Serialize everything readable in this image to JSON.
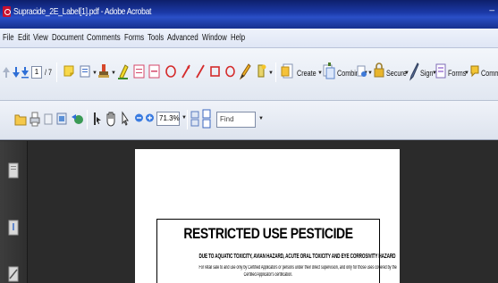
{
  "window": {
    "title": "Supracide_2E_Label[1].pdf - Adobe Acrobat",
    "minimize_glyph": "_"
  },
  "menu": [
    "File",
    "Edit",
    "View",
    "Document",
    "Comments",
    "Forms",
    "Tools",
    "Advanced",
    "Window",
    "Help"
  ],
  "toolbar": {
    "page_current": "1",
    "page_total": "/ 7",
    "create_label": "Create",
    "combine_label": "Combine",
    "secure_label": "Secure",
    "sign_label": "Sign",
    "forms_label": "Forms",
    "comment_label": "Comment"
  },
  "toolbar2": {
    "zoom_value": "71.3%",
    "find_placeholder": "Find"
  },
  "document": {
    "heading": "RESTRICTED USE PESTICIDE",
    "subheading": "DUE TO AQUATIC TOXICITY, AVIAN HAZARD, ACUTE ORAL TOXICITY AND EYE CORROSIVITY HAZARD",
    "body_line1": "For retail sale to and use only by Certified Applicators or persons under their direct supervision, and only for those uses covered by the",
    "body_line2": "Certified Applicator's certification."
  },
  "colors": {
    "titlebar": "#1c3aa8",
    "acrobat_red": "#c8102e",
    "workspace": "#2b2b2b"
  }
}
